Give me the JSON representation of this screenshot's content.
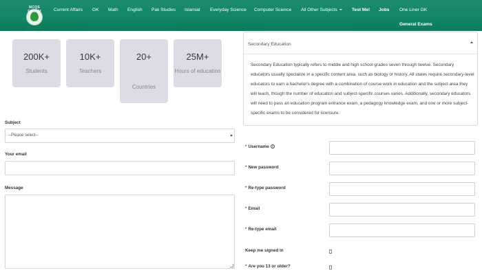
{
  "nav": {
    "logo_text": "MCQS FORUM",
    "items": [
      "Current Affairs",
      "GK",
      "Math",
      "English",
      "Pak Studies",
      "Islamiat",
      "Everyday Science",
      "Computer Science",
      "All Other Subjects",
      "Test Me!",
      "Jobs",
      "One Liner GK"
    ],
    "second_row": "General Exams"
  },
  "stats": [
    {
      "number": "200K+",
      "label": "Students"
    },
    {
      "number": "10K+",
      "label": "Teachers"
    },
    {
      "number": "20+",
      "label": "Countries"
    },
    {
      "number": "25M+",
      "label": "Hours of education"
    }
  ],
  "contact_form": {
    "subject_label": "Subject",
    "subject_value": "--Please select--",
    "email_label": "Your email",
    "message_label": "Message"
  },
  "panel": {
    "title": "Secondary Education",
    "body": "Secondary Education typically refers to middle and high school grades seven through twelve. Secondary educators usually specialize in a specific content area, such as biology or history. All states require secondary-level educators to earn a bachelor's degree with a combination of course work in education and the subject area they will teach, though the number of education and subject-specific courses varies. Additionally, secondary educators will need to pass an education program entrance exam, a pedagogy knowledge exam, and one or more subject-specific exams to be considered for licensure."
  },
  "register_form": {
    "required_mark": "*",
    "username_label": "Username",
    "username_info_icon": "info-icon",
    "new_password_label": "New password",
    "retype_password_label": "Re-type password",
    "email_label": "Email",
    "retype_email_label": "Re-type email",
    "keep_signed_in_label": "Keep me signed in",
    "age_label": "Are you 13 or older?"
  },
  "colors": {
    "nav_bg": "#118765",
    "stat_bg": "#dcdbe6",
    "required": "#dd2222"
  }
}
